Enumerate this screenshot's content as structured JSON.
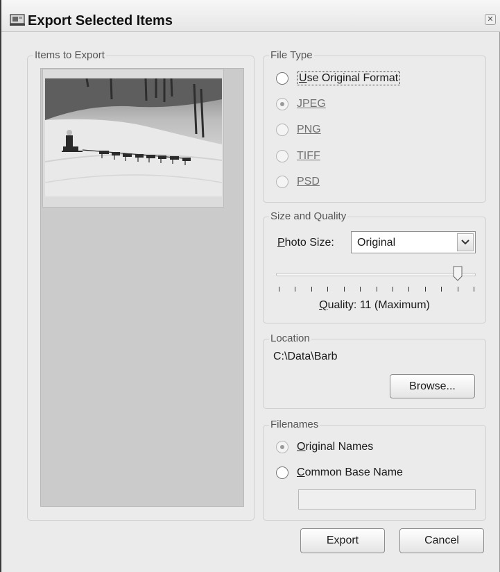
{
  "window": {
    "title": "Export Selected Items",
    "close_glyph": "✕"
  },
  "items_to_export": {
    "legend": "Items to Export",
    "items": [
      {
        "thumbnail": "dog-sled-snow-photo"
      }
    ]
  },
  "file_type": {
    "legend": "File Type",
    "options": [
      {
        "label": "Use Original Format",
        "mnemonic": "U",
        "rest": "se Original Format",
        "selected": false,
        "enabled": true
      },
      {
        "label": "JPEG",
        "selected": true,
        "enabled": false
      },
      {
        "label": "PNG",
        "selected": false,
        "enabled": false
      },
      {
        "label": "TIFF",
        "selected": false,
        "enabled": false
      },
      {
        "label": "PSD",
        "selected": false,
        "enabled": false
      }
    ]
  },
  "size_quality": {
    "legend": "Size and Quality",
    "photo_size_label": "Photo Size:",
    "photo_size_mnemonic": "P",
    "photo_size_rest": "hoto Size:",
    "photo_size_value": "Original",
    "quality_text": "Quality: 11 (Maximum)",
    "quality_mnemonic": "Q",
    "quality_rest": "uality: 11 (Maximum)",
    "quality_value": 11,
    "quality_min": 0,
    "quality_max": 12
  },
  "location": {
    "legend": "Location",
    "path": "C:\\Data\\Barb",
    "browse_label": "Browse..."
  },
  "filenames": {
    "legend": "Filenames",
    "original_names_label": "Original Names",
    "original_mnemonic": "O",
    "original_rest": "riginal Names",
    "common_base_label": "Common Base Name",
    "common_mnemonic": "C",
    "common_rest": "ommon Base Name",
    "base_name_value": ""
  },
  "buttons": {
    "export": "Export",
    "cancel": "Cancel"
  }
}
